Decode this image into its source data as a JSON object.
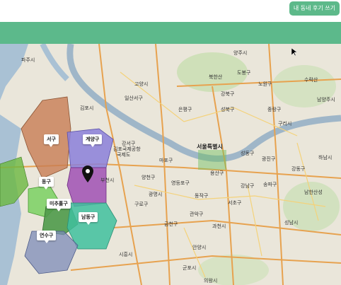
{
  "header": {
    "write_button": "내 동네 후기 쓰기"
  },
  "districts": [
    {
      "name": "서구"
    },
    {
      "name": "계양구"
    },
    {
      "name": "동구"
    },
    {
      "name": "미추홀구"
    },
    {
      "name": "남동구"
    },
    {
      "name": "연수구"
    }
  ],
  "places": [
    "김포시",
    "고양시",
    "서울특별시",
    "부천시",
    "광명시",
    "과천시",
    "안양시",
    "시흥시",
    "군포시",
    "의왕시",
    "구리시",
    "하남시",
    "남양주시",
    "양주시",
    "북한산",
    "도봉구",
    "노원구",
    "강북구",
    "성북구",
    "중랑구",
    "은평구",
    "마포구",
    "용산구",
    "강서구",
    "양천구",
    "영등포구",
    "동작구",
    "관악구",
    "서초구",
    "강남구",
    "송파구",
    "강동구",
    "광진구",
    "성동구",
    "구로구",
    "금천구",
    "파주시",
    "일산서구",
    "수락산",
    "김포국제공항",
    "남한산성",
    "성남시",
    "국제도"
  ],
  "colors": {
    "accent": "#5cb98b",
    "seo_gu": "#c87d54",
    "gyeyang_gu": "#8b7fd9",
    "bupyeong_gu": "#a050b4",
    "dong_gu": "#7ad061",
    "michuhol_gu": "#4f9a4a",
    "namdong_gu": "#3fbf9e",
    "yeonsu_gu": "#7c8bb8",
    "han_river": "#9fb6c8",
    "sea": "#a9c1d4"
  }
}
